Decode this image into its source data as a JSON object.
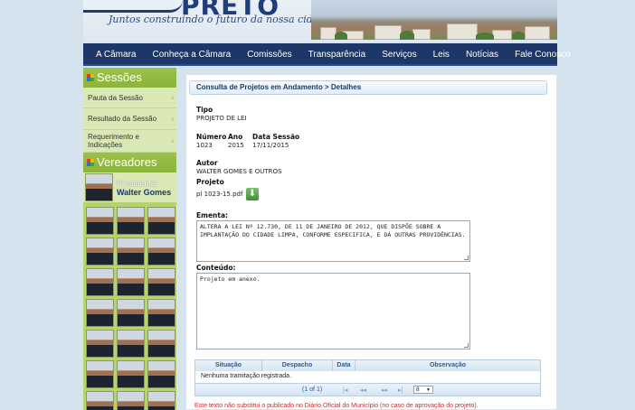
{
  "header": {
    "logo_text": "PRETO",
    "slogan": "Juntos construindo o futuro da nossa cidade"
  },
  "nav": {
    "items": [
      "A Câmara",
      "Conheça a Câmara",
      "Comissões",
      "Transparência",
      "Serviços",
      "Leis",
      "Notícias",
      "Fale Conosco"
    ]
  },
  "sidebar": {
    "sessoes_title": "Sessões",
    "sessoes_items": [
      "Pauta da Sessão",
      "Resultado da Sessão",
      "Requerimento e Indicações"
    ],
    "vereadores_title": "Vereadores",
    "president_label": "Presidente:",
    "president_name": "Walter Gomes"
  },
  "breadcrumb": "Consulta de Projetos em Andamento > Detalhes",
  "detail": {
    "tipo_label": "Tipo",
    "tipo_value": "PROJETO DE LEI",
    "numero_label": "Número",
    "numero_value": "1023",
    "ano_label": "Ano",
    "ano_value": "2015",
    "data_label": "Data Sessão",
    "data_value": "17/11/2015",
    "autor_label": "Autor",
    "autor_value": "WALTER GOMES E OUTROS",
    "projeto_label": "Projeto",
    "projeto_file": "pl 1023-15.pdf",
    "ementa_label": "Ementa:",
    "ementa_value": "ALTERA A LEI Nº 12.730, DE 11 DE JANEIRO DE 2012, QUE DISPÕE SOBRE A IMPLANTAÇÃO DO CIDADE LIMPA, CONFORME ESPECIFICA, E DÁ OUTRAS PROVIDÊNCIAS.",
    "conteudo_label": "Conteúdo:",
    "conteudo_value": "Projeto em anexo."
  },
  "table": {
    "headers": [
      "Situação",
      "Despacho",
      "Data",
      "Observação"
    ],
    "empty_message": "Nenhuma tramitação registrada.",
    "pager_info": "(1 of 1)",
    "page_size": "8"
  },
  "disclaimer": "Este texto não substitui o publicado no Diário Oficial do Município (no caso de aprovação do projeto).",
  "colors": {
    "nav_bg": "#1c3768",
    "sidebar_green": "#9dc14b",
    "link_blue": "#2a5aa0",
    "disclaimer_red": "#cc2a2a"
  }
}
